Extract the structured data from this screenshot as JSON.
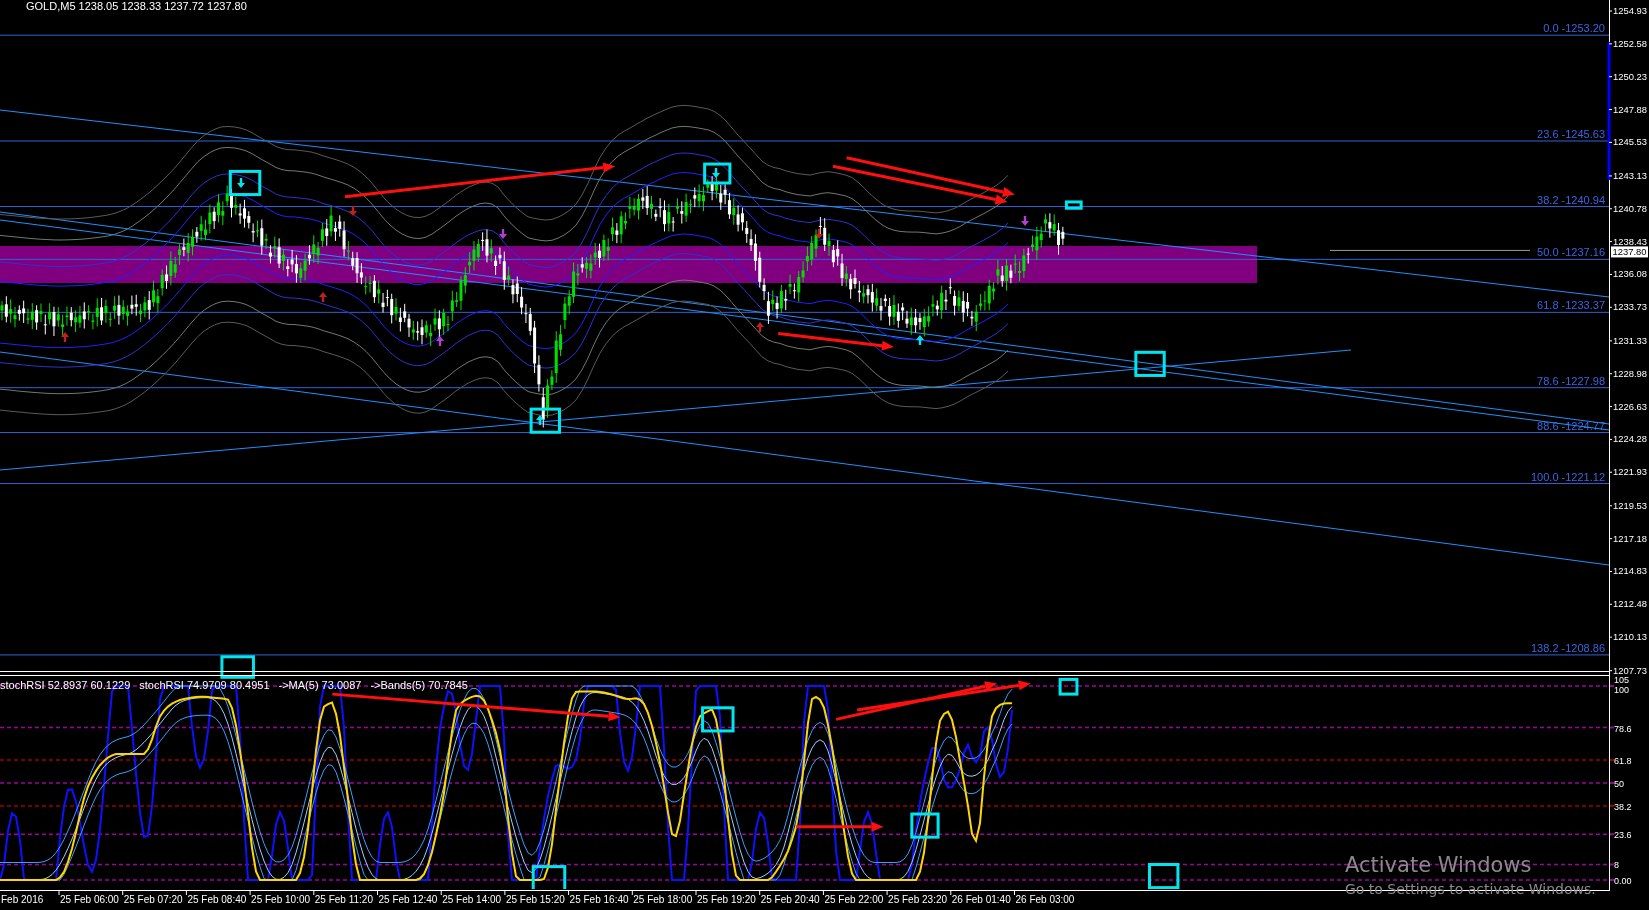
{
  "chart": {
    "title": "GOLD,M5 1238.05 1238.33 1237.72 1237.80",
    "price_axis": {
      "labels": [
        "1254.93",
        "1252.58",
        "1250.23",
        "1247.88",
        "1245.53",
        "1243.13",
        "1240.78",
        "1238.43",
        "1236.08",
        "1233.73",
        "1231.33",
        "1228.98",
        "1226.63",
        "1224.28",
        "1221.93",
        "1219.53",
        "1217.18",
        "1214.83",
        "1212.48",
        "1210.13",
        "1207.73"
      ],
      "current": "1237.80"
    },
    "fibonacci": [
      "0.0 -1253.20",
      "23.6 -1245.63",
      "38.2 -1240.94",
      "50.0 -1237.16",
      "61.8 -1233.37",
      "78.6 -1227.98",
      "88.6 -1224.77",
      "100.0 -1221.12",
      "138.2 -1208.86"
    ]
  },
  "indicator": {
    "header": [
      "stochRSI 52.8937 60.1229",
      "stochRSI 74.9709 80.4951",
      "->MA(5) 73.0087",
      "->Bands(5) 70.7845"
    ],
    "scale": [
      {
        "label": "105"
      },
      {
        "label": "100",
        "color": "#a000a0"
      },
      {
        "label": "78.6",
        "color": "#a000a0"
      },
      {
        "label": "61.8",
        "color": "#a00000"
      },
      {
        "label": "50",
        "color": "#a000a0"
      },
      {
        "label": "38.2",
        "color": "#a00000"
      },
      {
        "label": "23.6",
        "color": "#a000a0"
      },
      {
        "label": "8",
        "color": "#a000a0"
      },
      {
        "label": "0.00",
        "color": "#a000a0"
      }
    ]
  },
  "time_axis": [
    "Feb 2016",
    "25 Feb 06:00",
    "25 Feb 07:20",
    "25 Feb 08:40",
    "25 Feb 10:00",
    "25 Feb 11:20",
    "25 Feb 12:40",
    "25 Feb 14:00",
    "25 Feb 15:20",
    "25 Feb 16:40",
    "25 Feb 18:00",
    "25 Feb 19:20",
    "25 Feb 20:40",
    "25 Feb 22:00",
    "25 Feb 23:20",
    "26 Feb 01:40",
    "26 Feb 03:00"
  ],
  "system_notice": {
    "title": "Activate Windows",
    "message": "Go to Settings to activate Windows."
  }
}
